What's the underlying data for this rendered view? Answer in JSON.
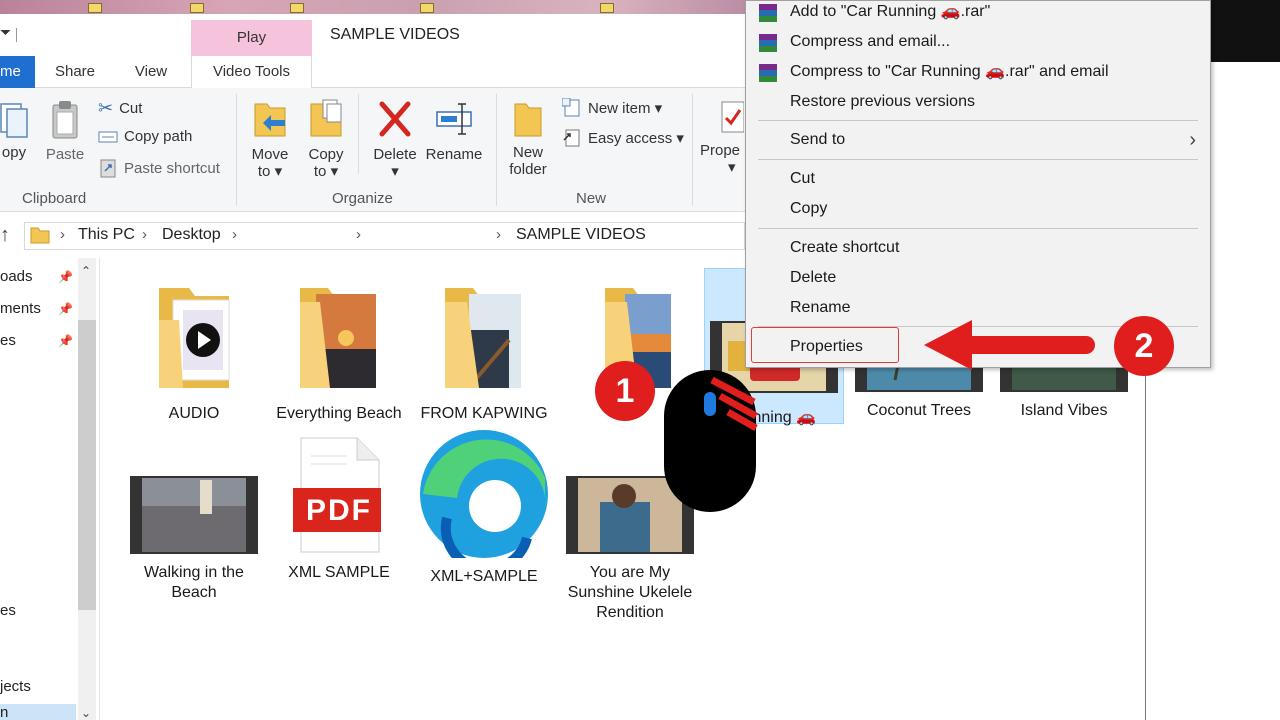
{
  "window": {
    "title": "SAMPLE VIDEOS",
    "contextual_tab": "Play"
  },
  "tabs": [
    "me",
    "Share",
    "View",
    "Video Tools"
  ],
  "ribbon": {
    "clipboard": {
      "copy": "opy",
      "paste": "Paste",
      "cut": "Cut",
      "copy_path": "Copy path",
      "paste_shortcut": "Paste shortcut",
      "group": "Clipboard"
    },
    "organize": {
      "move_to": "Move",
      "move_to2": "to ▾",
      "copy_to": "Copy",
      "copy_to2": "to ▾",
      "delete": "Delete",
      "delete2": "▾",
      "rename": "Rename",
      "group": "Organize"
    },
    "new": {
      "new_folder": "New",
      "new_folder2": "folder",
      "new_item": "New item ▾",
      "easy_access": "Easy access ▾",
      "group": "New"
    },
    "open": {
      "properties": "Prope",
      "properties2": "▾"
    }
  },
  "address": {
    "crumbs": [
      "This PC",
      "Desktop",
      "SAMPLE VIDEOS"
    ]
  },
  "nav": {
    "items": [
      "oads",
      "ments",
      "es",
      "es",
      "jects",
      "n"
    ]
  },
  "files": [
    {
      "name": "AUDIO",
      "type": "folder-audio"
    },
    {
      "name": "Everything Beach",
      "type": "folder-photo"
    },
    {
      "name": "FROM KAPWING",
      "type": "folder-photo"
    },
    {
      "name": "",
      "type": "folder-photo"
    },
    {
      "name": "Running 🚗",
      "type": "video"
    },
    {
      "name": "Coconut Trees",
      "type": "video"
    },
    {
      "name": "Island Vibes",
      "type": "video"
    },
    {
      "name": "Walking in the Beach",
      "type": "video"
    },
    {
      "name": "XML SAMPLE",
      "type": "pdf"
    },
    {
      "name": "XML+SAMPLE",
      "type": "edge"
    },
    {
      "name": "You are My Sunshine Ukelele Rendition",
      "type": "video"
    }
  ],
  "pdf_label": "PDF",
  "context_menu": {
    "items": [
      "Add to \"Car Running 🚗.rar\"",
      "Compress and email...",
      "Compress to \"Car Running 🚗.rar\" and email",
      "Restore previous versions",
      "Send to",
      "Cut",
      "Copy",
      "Create shortcut",
      "Delete",
      "Rename",
      "Properties"
    ]
  },
  "annotations": {
    "step1": "1",
    "step2": "2"
  },
  "colors": {
    "accent": "#1f6fd0",
    "annotation_red": "#e01e1e",
    "play_tab": "#f6c3dc",
    "selection": "#cce8ff"
  }
}
